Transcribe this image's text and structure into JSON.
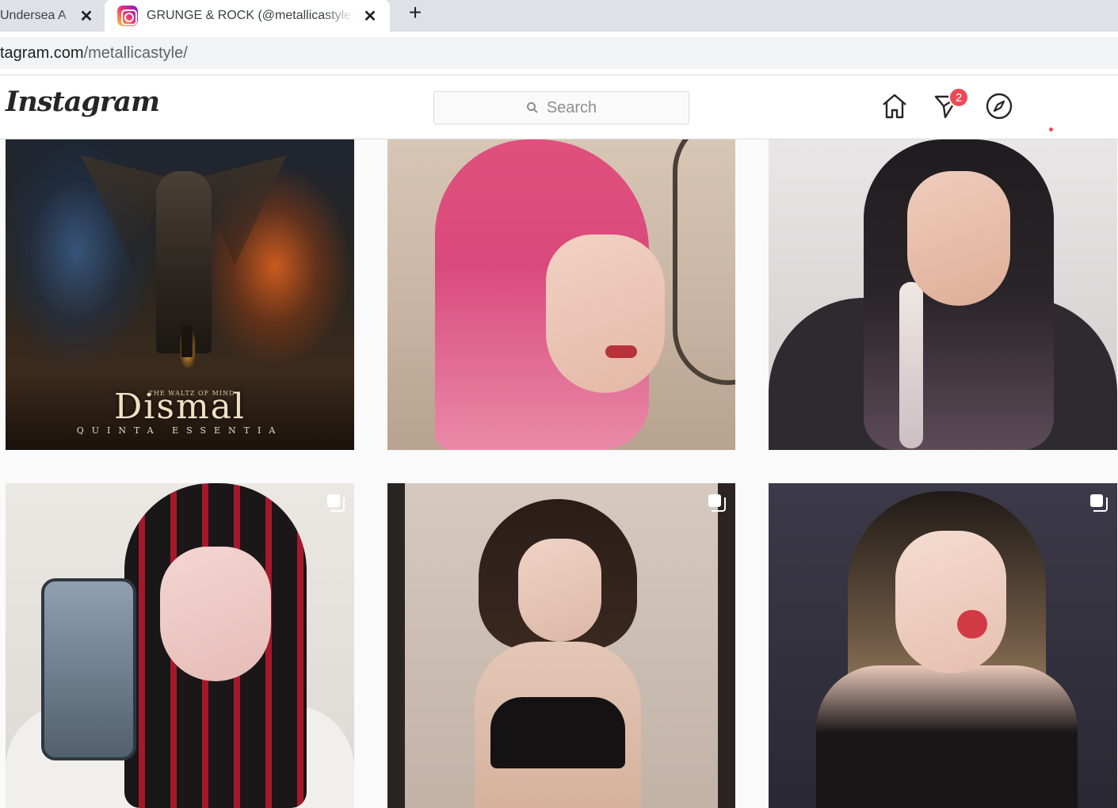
{
  "browser": {
    "tabs": [
      {
        "title": "Undersea A",
        "active": false
      },
      {
        "title": "GRUNGE & ROCK (@metallicastyle)",
        "active": true
      }
    ],
    "close_symbol": "✕",
    "new_tab_symbol": "+",
    "address": {
      "host": "tagram.com",
      "path": "/metallicastyle/"
    }
  },
  "instagram": {
    "logo": "Instagram",
    "search_placeholder": "Search",
    "nav": {
      "home_icon": "home-icon",
      "direct_icon": "direct-message-icon",
      "explore_icon": "explore-compass-icon",
      "direct_badge_count": "2"
    },
    "colors": {
      "badge": "#ed4956",
      "border": "#dbdbdb",
      "text_muted": "#8e8e8e"
    }
  },
  "posts": [
    {
      "kind": "album-cover",
      "multi": false,
      "title": "Dismal",
      "subtitle": "THE WALTZ OF MIND",
      "credit": "QUINTA ESSENTIA"
    },
    {
      "kind": "photo",
      "multi": false
    },
    {
      "kind": "photo",
      "multi": false
    },
    {
      "kind": "photo",
      "multi": true
    },
    {
      "kind": "photo",
      "multi": true
    },
    {
      "kind": "photo",
      "multi": true
    }
  ]
}
